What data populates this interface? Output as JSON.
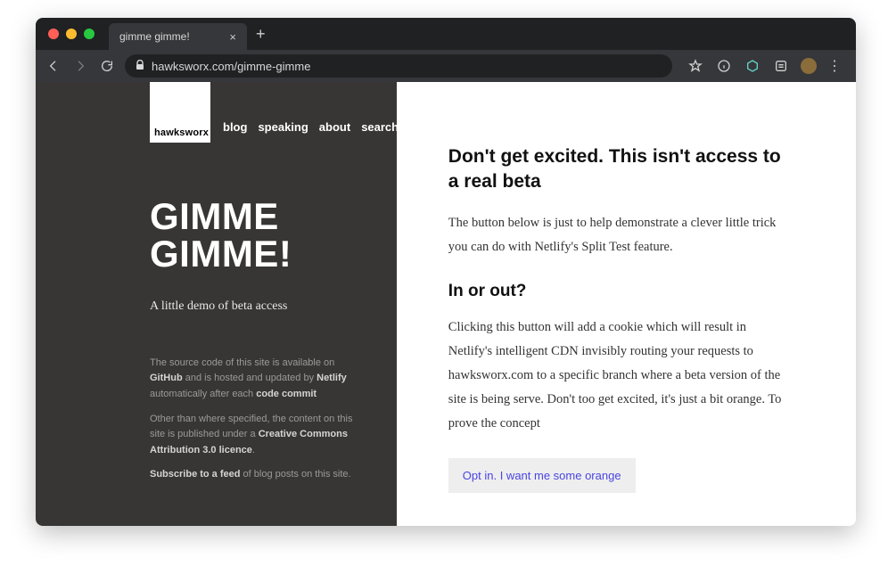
{
  "chrome": {
    "tab_title": "gimme gimme!",
    "url_display": "hawksworx.com/gimme-gimme"
  },
  "sidebar": {
    "logo_text": "hawksworx",
    "nav": [
      "blog",
      "speaking",
      "about",
      "search"
    ],
    "hero": "GIMME GIMME!",
    "sub": "A little demo of beta access",
    "footer": {
      "l1a": "The source code of this site is available on ",
      "l1b": "GitHub",
      "l1c": " and is hosted and updated by ",
      "l1d": "Netlify",
      "l1e": " automatically after each ",
      "l1f": "code commit",
      "l2a": "Other than where specified, the content on this site is published under a ",
      "l2b": "Creative Commons Attribution 3.0 licence",
      "l2c": ".",
      "l3a": "Subscribe to a feed",
      "l3b": " of blog posts on this site."
    }
  },
  "main": {
    "h1": "Don't get excited. This isn't access to a real beta",
    "p1": "The button below is just to help demonstrate a clever little trick you can do with Netlify's Split Test feature.",
    "h2": "In or out?",
    "p2": "Clicking this button will add a cookie which will result in Netlify's intelligent CDN invisibly routing your requests to hawksworx.com to a specific branch where a beta version of the site is being serve. Don't too get excited, it's just a bit orange. To prove the concept",
    "cta": "Opt in. I want me some orange"
  }
}
